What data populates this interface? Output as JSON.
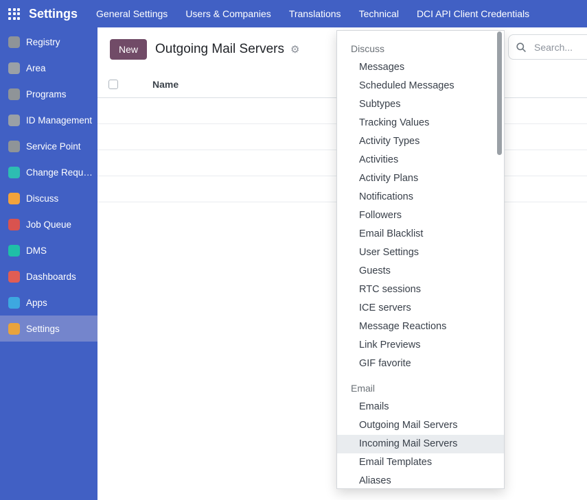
{
  "topbar": {
    "brand": "Settings",
    "menu": [
      "General Settings",
      "Users & Companies",
      "Translations",
      "Technical",
      "DCI API Client Credentials"
    ]
  },
  "sidebar": {
    "items": [
      {
        "label": "Registry",
        "name": "registry",
        "icon_color": "#8f9498",
        "active": false
      },
      {
        "label": "Area",
        "name": "area",
        "icon_color": "#9aa0a6",
        "active": false
      },
      {
        "label": "Programs",
        "name": "programs",
        "icon_color": "#8f9498",
        "active": false
      },
      {
        "label": "ID Management",
        "name": "id-management",
        "icon_color": "#9aa0a6",
        "active": false
      },
      {
        "label": "Service Point",
        "name": "service-point",
        "icon_color": "#8f9498",
        "active": false
      },
      {
        "label": "Change Requ…",
        "name": "change-requests",
        "icon_color": "#2dbdb2",
        "active": false
      },
      {
        "label": "Discuss",
        "name": "discuss",
        "icon_color": "#f2a33c",
        "active": false
      },
      {
        "label": "Job Queue",
        "name": "job-queue",
        "icon_color": "#d9534f",
        "active": false
      },
      {
        "label": "DMS",
        "name": "dms",
        "icon_color": "#1fbfa7",
        "active": false
      },
      {
        "label": "Dashboards",
        "name": "dashboards",
        "icon_color": "#e05d54",
        "active": false
      },
      {
        "label": "Apps",
        "name": "apps",
        "icon_color": "#3da8e0",
        "active": false
      },
      {
        "label": "Settings",
        "name": "settings",
        "icon_color": "#e8a33d",
        "active": true
      }
    ]
  },
  "content": {
    "new_button_label": "New",
    "page_title": "Outgoing Mail Servers",
    "search_placeholder": "Search...",
    "table": {
      "columns": [
        "Name"
      ],
      "empty_row_count": 4
    }
  },
  "dropdown": {
    "sections": [
      {
        "header": "Discuss",
        "items": [
          "Messages",
          "Scheduled Messages",
          "Subtypes",
          "Tracking Values",
          "Activity Types",
          "Activities",
          "Activity Plans",
          "Notifications",
          "Followers",
          "Email Blacklist",
          "User Settings",
          "Guests",
          "RTC sessions",
          "ICE servers",
          "Message Reactions",
          "Link Previews",
          "GIF favorite"
        ],
        "active_item": ""
      },
      {
        "header": "Email",
        "items": [
          "Emails",
          "Outgoing Mail Servers",
          "Incoming Mail Servers",
          "Email Templates",
          "Aliases"
        ],
        "active_item": "Incoming Mail Servers"
      }
    ]
  },
  "colors": {
    "topbar_bg": "#4160c4",
    "sidebar_active_bg": "#7485cc",
    "new_button_bg": "#714b67",
    "dropdown_active_bg": "#e9ecef"
  }
}
